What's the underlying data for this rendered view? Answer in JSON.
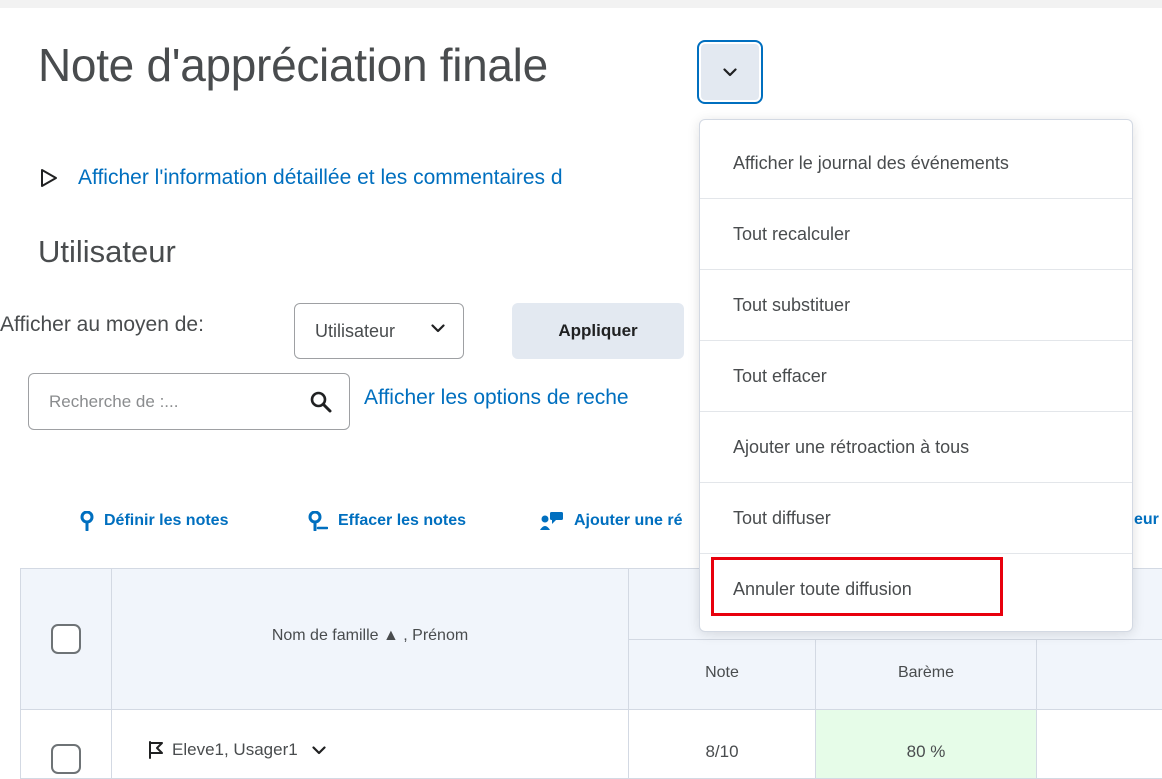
{
  "header": {
    "title": "Note d'appréciation finale"
  },
  "details_link": "Afficher l'information détaillée et les commentaires d",
  "section_title": "Utilisateur",
  "view_by": {
    "label": "Afficher au moyen de:",
    "selected": "Utilisateur",
    "apply_label": "Appliquer"
  },
  "search": {
    "placeholder": "Recherche de :...",
    "options_link": "Afficher les options de reche"
  },
  "toolbar": {
    "set_grades": "Définir les notes",
    "clear_grades": "Effacer les notes",
    "add_feedback": "Ajouter une ré",
    "truncated": "eur"
  },
  "table": {
    "name_header": "Nom de famille ▲ , Prénom",
    "col_grade": "Note",
    "col_scheme": "Barème",
    "rows": [
      {
        "name": "Eleve1, Usager1",
        "grade": "8/10",
        "scheme": "80 %"
      }
    ]
  },
  "dropdown": {
    "items": [
      "Afficher le journal des événements",
      "Tout recalculer",
      "Tout substituer",
      "Tout effacer",
      "Ajouter une rétroaction à tous",
      "Tout diffuser",
      "Annuler toute diffusion"
    ]
  },
  "icons": {
    "menu_chevron": "chevron-down-icon",
    "expander": "triangle-right-icon",
    "search": "search-icon",
    "set_grades": "pin-icon",
    "clear_grades": "pin-clear-icon",
    "add_feedback": "feedback-icon",
    "row_flag": "flag-icon"
  },
  "colors": {
    "link": "#006fbf",
    "highlight": "#e8000d",
    "scheme_cell": "#e6fce8"
  }
}
